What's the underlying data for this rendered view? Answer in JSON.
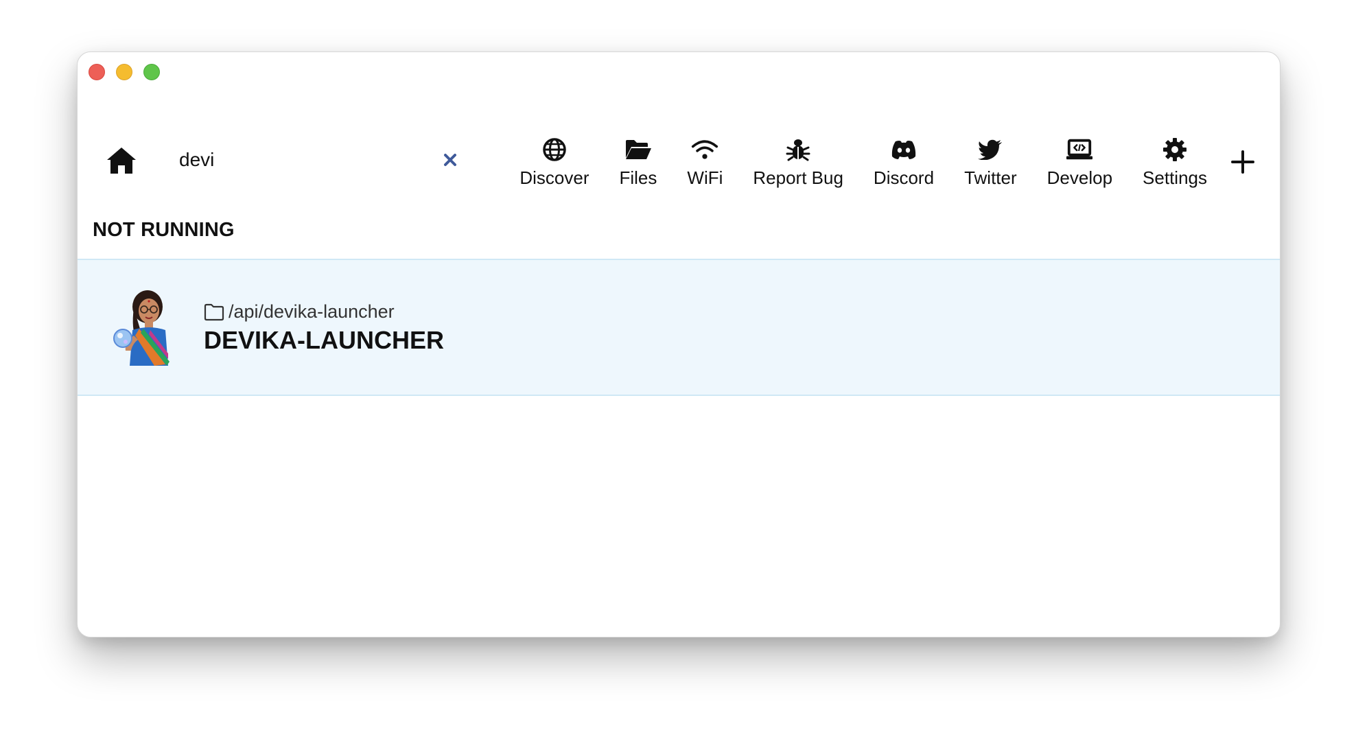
{
  "toolbar": {
    "search_value": "devi",
    "nav": [
      {
        "label": "Discover",
        "icon": "globe-icon"
      },
      {
        "label": "Files",
        "icon": "folder-open-icon"
      },
      {
        "label": "WiFi",
        "icon": "wifi-icon"
      },
      {
        "label": "Report Bug",
        "icon": "bug-icon"
      },
      {
        "label": "Discord",
        "icon": "discord-icon"
      },
      {
        "label": "Twitter",
        "icon": "twitter-icon"
      },
      {
        "label": "Develop",
        "icon": "code-laptop-icon"
      },
      {
        "label": "Settings",
        "icon": "gear-icon"
      }
    ]
  },
  "section": {
    "title": "NOT RUNNING"
  },
  "apps": [
    {
      "path": "/api/devika-launcher",
      "name": "DEVIKA-LAUNCHER"
    }
  ],
  "colors": {
    "accent_clear": "#3f5a9a",
    "row_bg": "#eef7fd",
    "row_border": "#cfe8f5"
  }
}
